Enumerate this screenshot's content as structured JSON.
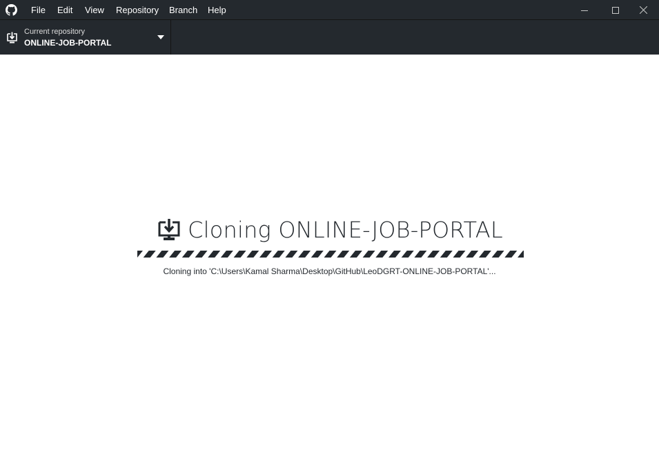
{
  "menu": {
    "items": [
      {
        "id": "file",
        "label": "File"
      },
      {
        "id": "edit",
        "label": "Edit"
      },
      {
        "id": "view",
        "label": "View"
      },
      {
        "id": "repository",
        "label": "Repository"
      },
      {
        "id": "branch",
        "label": "Branch"
      },
      {
        "id": "help",
        "label": "Help"
      }
    ]
  },
  "window_controls": [
    "minimize-icon",
    "maximize-icon",
    "close-icon"
  ],
  "toolbar": {
    "repository": {
      "caption": "Current repository",
      "name": "ONLINE-JOB-PORTAL",
      "icon": "repo-clone-icon",
      "dropdown_icon": "triangle-down-icon"
    }
  },
  "clone": {
    "icon": "clone-download-icon",
    "title": "Cloning ONLINE-JOB-PORTAL",
    "status": "Cloning into 'C:\\Users\\Kamal Sharma\\Desktop\\GitHub\\LeoDGRT-ONLINE-JOB-PORTAL'...",
    "progress": "indeterminate"
  },
  "colors": {
    "chrome_bg": "#24292e",
    "text_dark": "#24292e",
    "page_bg": "#ffffff"
  }
}
